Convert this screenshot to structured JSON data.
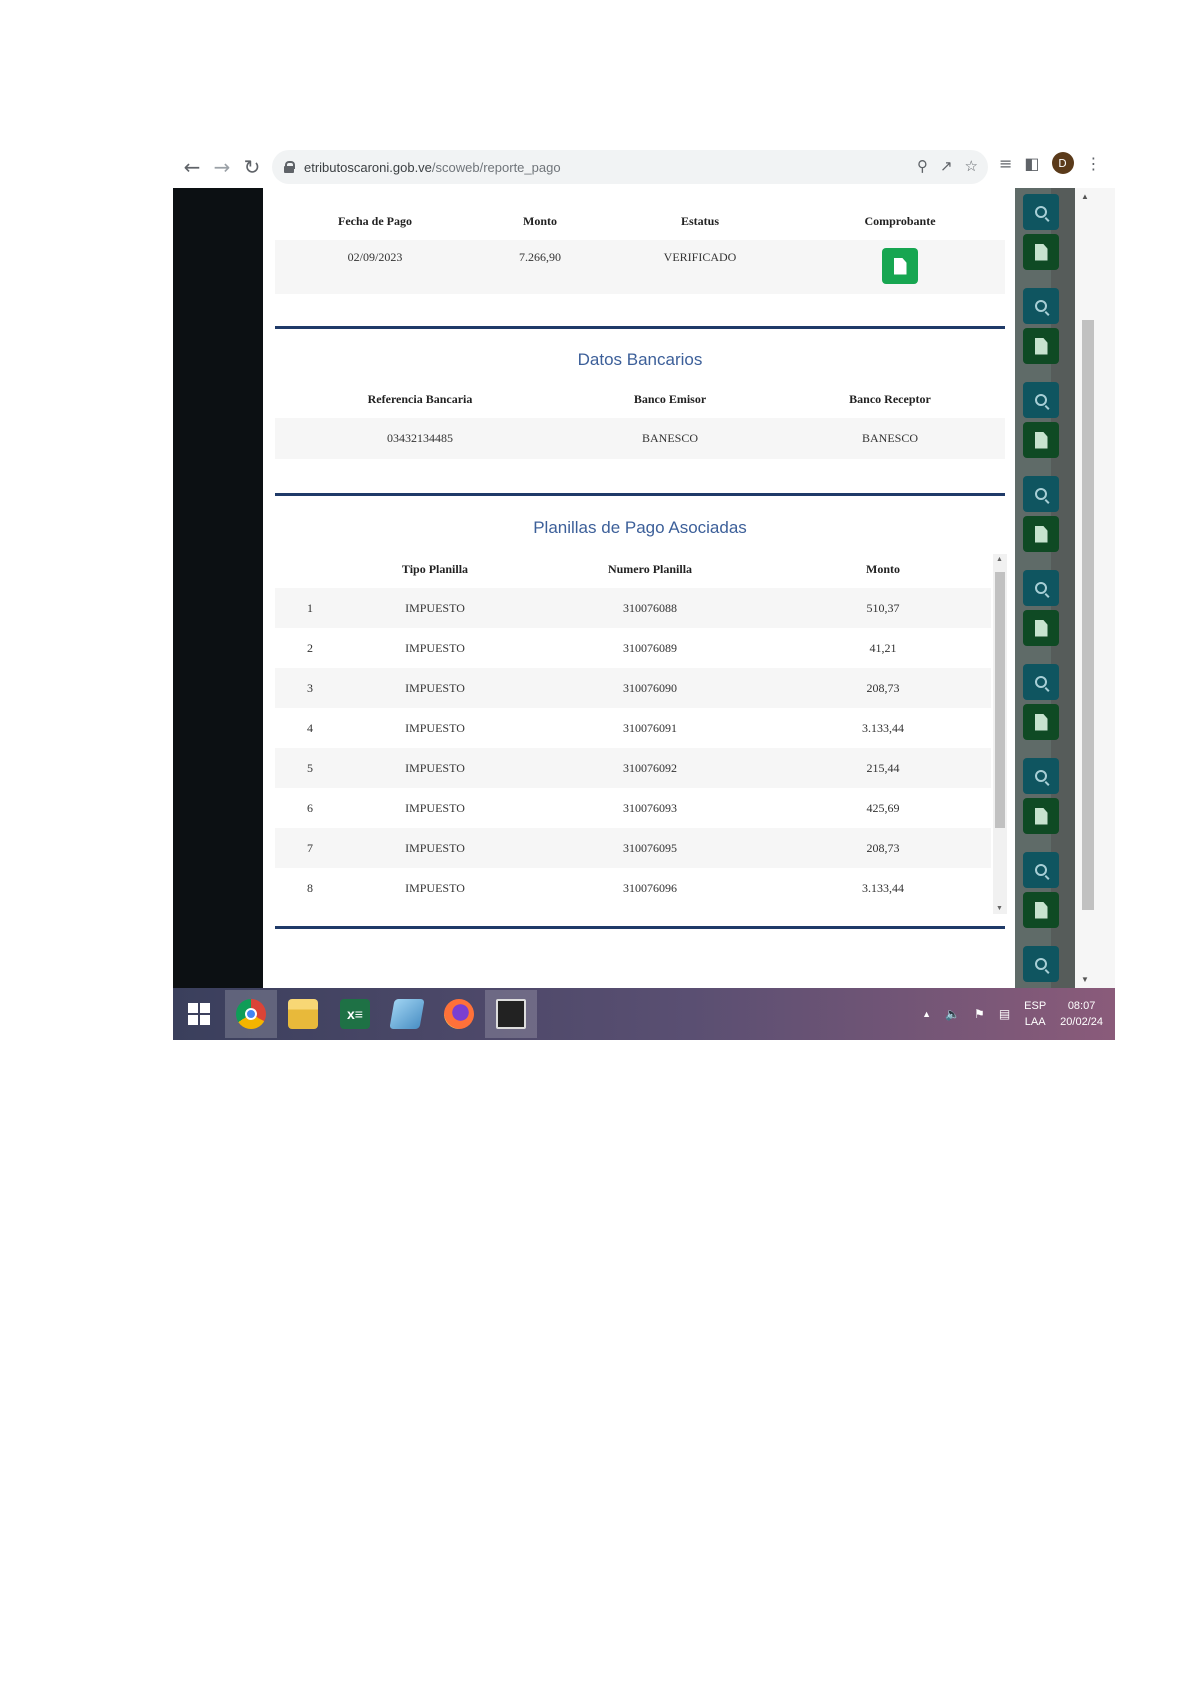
{
  "browser": {
    "url_host": "etributoscaroni.gob.ve",
    "url_path": "/scoweb/reporte_pago",
    "profile_initial": "D"
  },
  "pago": {
    "headers": [
      "Fecha de Pago",
      "Monto",
      "Estatus",
      "Comprobante"
    ],
    "row": {
      "fecha": "02/09/2023",
      "monto": "7.266,90",
      "estatus": "VERIFICADO"
    }
  },
  "datos_bancarios": {
    "title": "Datos Bancarios",
    "headers": [
      "Referencia Bancaria",
      "Banco Emisor",
      "Banco Receptor"
    ],
    "row": {
      "referencia": "03432134485",
      "emisor": "BANESCO",
      "receptor": "BANESCO"
    }
  },
  "planillas": {
    "title": "Planillas de Pago Asociadas",
    "headers": [
      "",
      "Tipo Planilla",
      "Numero Planilla",
      "Monto"
    ],
    "rows": [
      {
        "n": "1",
        "tipo": "IMPUESTO",
        "numero": "310076088",
        "monto": "510,37"
      },
      {
        "n": "2",
        "tipo": "IMPUESTO",
        "numero": "310076089",
        "monto": "41,21"
      },
      {
        "n": "3",
        "tipo": "IMPUESTO",
        "numero": "310076090",
        "monto": "208,73"
      },
      {
        "n": "4",
        "tipo": "IMPUESTO",
        "numero": "310076091",
        "monto": "3.133,44"
      },
      {
        "n": "5",
        "tipo": "IMPUESTO",
        "numero": "310076092",
        "monto": "215,44"
      },
      {
        "n": "6",
        "tipo": "IMPUESTO",
        "numero": "310076093",
        "monto": "425,69"
      },
      {
        "n": "7",
        "tipo": "IMPUESTO",
        "numero": "310076095",
        "monto": "208,73"
      },
      {
        "n": "8",
        "tipo": "IMPUESTO",
        "numero": "310076096",
        "monto": "3.133,44"
      }
    ]
  },
  "taskbar": {
    "lang_top": "ESP",
    "lang_bottom": "LAA",
    "time": "08:07",
    "date": "20/02/24"
  },
  "icons": {
    "back": "arrow-left-icon",
    "forward": "arrow-right-icon",
    "reload": "reload-icon",
    "search": "search-icon",
    "document": "document-icon"
  },
  "colors": {
    "accent_blue": "#1f3a68",
    "title_blue": "#3c5f99",
    "comprobante_green": "#17a651",
    "search_btn_teal": "#0f5560",
    "doc_btn_green": "#0f4a24"
  }
}
